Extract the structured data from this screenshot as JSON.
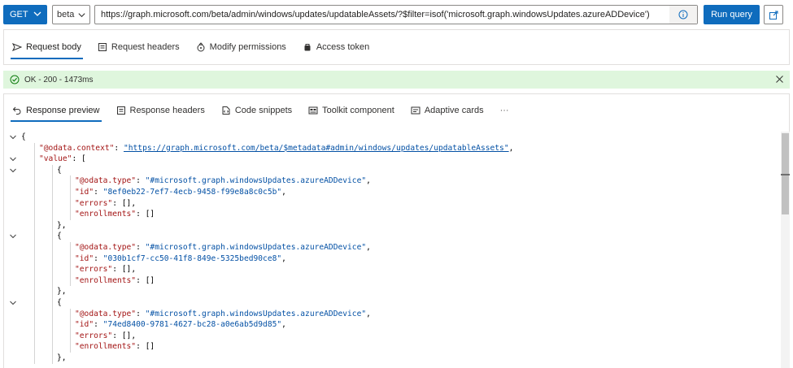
{
  "query": {
    "method": "GET",
    "version": "beta",
    "url": "https://graph.microsoft.com/beta/admin/windows/updates/updatableAssets/?$filter=isof('microsoft.graph.windowsUpdates.azureADDevice')",
    "run_label": "Run query"
  },
  "request_tabs": [
    {
      "label": "Request body",
      "icon": "send-icon",
      "active": true
    },
    {
      "label": "Request headers",
      "icon": "headers-icon",
      "active": false
    },
    {
      "label": "Modify permissions",
      "icon": "lock-key-icon",
      "active": false
    },
    {
      "label": "Access token",
      "icon": "token-icon",
      "active": false
    }
  ],
  "status": {
    "text": "OK - 200 - 1473ms",
    "color": "#dff6dd"
  },
  "response_tabs": [
    {
      "label": "Response preview",
      "icon": "undo-arrow-icon",
      "active": true
    },
    {
      "label": "Response headers",
      "icon": "headers-icon",
      "active": false
    },
    {
      "label": "Code snippets",
      "icon": "code-doc-icon",
      "active": false
    },
    {
      "label": "Toolkit component",
      "icon": "toolkit-icon",
      "active": false
    },
    {
      "label": "Adaptive cards",
      "icon": "card-icon",
      "active": false
    },
    {
      "label": "···",
      "icon": "",
      "active": false
    }
  ],
  "response_lines": [
    {
      "indent": 0,
      "fold": true,
      "parts": [
        [
          "p",
          "{"
        ]
      ]
    },
    {
      "indent": 1,
      "fold": false,
      "parts": [
        [
          "k",
          "\"@odata.context\""
        ],
        [
          "p",
          ": "
        ],
        [
          "u",
          "\"https://graph.microsoft.com/beta/$metadata#admin/windows/updates/updatableAssets\""
        ],
        [
          "p",
          ","
        ]
      ]
    },
    {
      "indent": 1,
      "fold": true,
      "parts": [
        [
          "k",
          "\"value\""
        ],
        [
          "p",
          ": ["
        ]
      ]
    },
    {
      "indent": 2,
      "fold": true,
      "parts": [
        [
          "p",
          "{"
        ]
      ]
    },
    {
      "indent": 3,
      "fold": false,
      "parts": [
        [
          "k",
          "\"@odata.type\""
        ],
        [
          "p",
          ": "
        ],
        [
          "s",
          "\"#microsoft.graph.windowsUpdates.azureADDevice\""
        ],
        [
          "p",
          ","
        ]
      ]
    },
    {
      "indent": 3,
      "fold": false,
      "parts": [
        [
          "k",
          "\"id\""
        ],
        [
          "p",
          ": "
        ],
        [
          "s",
          "\"8ef0eb22-7ef7-4ecb-9458-f99e8a8c0c5b\""
        ],
        [
          "p",
          ","
        ]
      ]
    },
    {
      "indent": 3,
      "fold": false,
      "parts": [
        [
          "k",
          "\"errors\""
        ],
        [
          "p",
          ": [],"
        ]
      ]
    },
    {
      "indent": 3,
      "fold": false,
      "parts": [
        [
          "k",
          "\"enrollments\""
        ],
        [
          "p",
          ": []"
        ]
      ]
    },
    {
      "indent": 2,
      "fold": false,
      "parts": [
        [
          "p",
          "},"
        ]
      ]
    },
    {
      "indent": 2,
      "fold": true,
      "parts": [
        [
          "p",
          "{"
        ]
      ]
    },
    {
      "indent": 3,
      "fold": false,
      "parts": [
        [
          "k",
          "\"@odata.type\""
        ],
        [
          "p",
          ": "
        ],
        [
          "s",
          "\"#microsoft.graph.windowsUpdates.azureADDevice\""
        ],
        [
          "p",
          ","
        ]
      ]
    },
    {
      "indent": 3,
      "fold": false,
      "parts": [
        [
          "k",
          "\"id\""
        ],
        [
          "p",
          ": "
        ],
        [
          "s",
          "\"030b1cf7-cc50-41f8-849e-5325bed90ce8\""
        ],
        [
          "p",
          ","
        ]
      ]
    },
    {
      "indent": 3,
      "fold": false,
      "parts": [
        [
          "k",
          "\"errors\""
        ],
        [
          "p",
          ": [],"
        ]
      ]
    },
    {
      "indent": 3,
      "fold": false,
      "parts": [
        [
          "k",
          "\"enrollments\""
        ],
        [
          "p",
          ": []"
        ]
      ]
    },
    {
      "indent": 2,
      "fold": false,
      "parts": [
        [
          "p",
          "},"
        ]
      ]
    },
    {
      "indent": 2,
      "fold": true,
      "parts": [
        [
          "p",
          "{"
        ]
      ]
    },
    {
      "indent": 3,
      "fold": false,
      "parts": [
        [
          "k",
          "\"@odata.type\""
        ],
        [
          "p",
          ": "
        ],
        [
          "s",
          "\"#microsoft.graph.windowsUpdates.azureADDevice\""
        ],
        [
          "p",
          ","
        ]
      ]
    },
    {
      "indent": 3,
      "fold": false,
      "parts": [
        [
          "k",
          "\"id\""
        ],
        [
          "p",
          ": "
        ],
        [
          "s",
          "\"74ed8400-9781-4627-bc28-a0e6ab5d9d85\""
        ],
        [
          "p",
          ","
        ]
      ]
    },
    {
      "indent": 3,
      "fold": false,
      "parts": [
        [
          "k",
          "\"errors\""
        ],
        [
          "p",
          ": [],"
        ]
      ]
    },
    {
      "indent": 3,
      "fold": false,
      "parts": [
        [
          "k",
          "\"enrollments\""
        ],
        [
          "p",
          ": []"
        ]
      ]
    },
    {
      "indent": 2,
      "fold": false,
      "parts": [
        [
          "p",
          "},"
        ]
      ]
    }
  ],
  "colors": {
    "accent": "#0f6cbd",
    "json_key": "#a31515",
    "json_string": "#0451a5"
  }
}
